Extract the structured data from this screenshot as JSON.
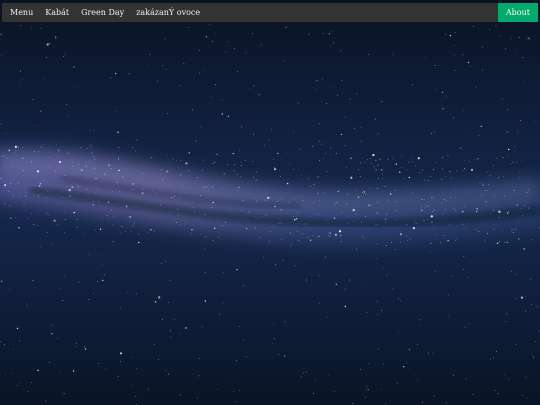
{
  "navbar": {
    "items": [
      {
        "label": "Menu"
      },
      {
        "label": "Kabát"
      },
      {
        "label": "Green Day"
      },
      {
        "label": "zakázanÝ ovoce"
      }
    ],
    "about_label": "About"
  },
  "colors": {
    "navbar_bg": "#333333",
    "nav_text": "#f2f2f2",
    "about_bg": "#04aa6d",
    "sky_bg": "#0b1426"
  },
  "background": {
    "image": "starry-night-sky-milky-way"
  }
}
